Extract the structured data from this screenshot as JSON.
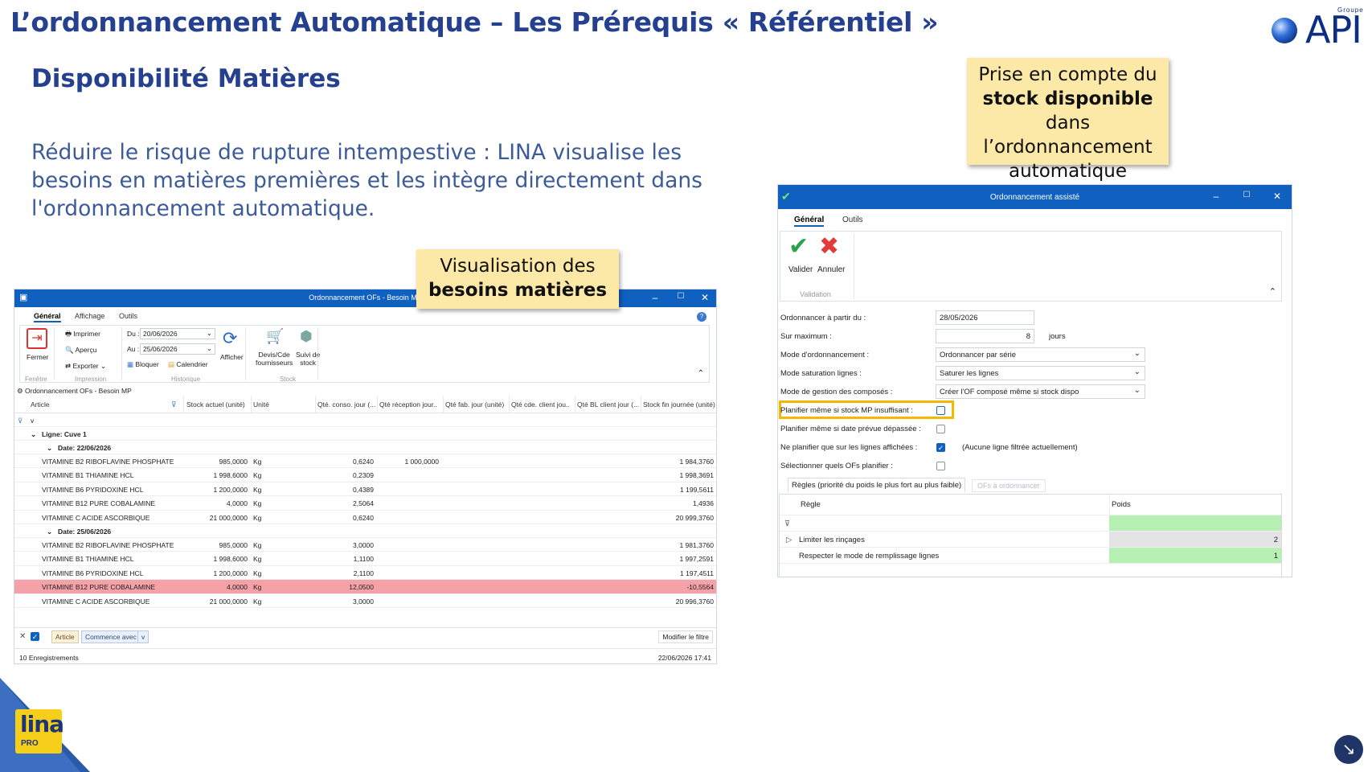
{
  "slide": {
    "title": "L’ordonnancement Automatique – Les Prérequis « Référentiel »",
    "subtitle": "Disponibilité Matières",
    "intro": "Réduire le risque de rupture intempestive : LINA visualise les besoins en matières premières et les intègre directement dans l'ordonnancement automatique.",
    "logo_text": "API",
    "logo_small": "Groupe"
  },
  "callouts": {
    "left_line1": "Visualisation des",
    "left_line2": "besoins matières",
    "right_line1": "Prise en compte du",
    "right_bold": "stock disponible",
    "right_rest": " dans l’ordonnancement automatique"
  },
  "left_window": {
    "title": "Ordonnancement OFs - Besoin MP",
    "tabs": [
      "Général",
      "Affichage",
      "Outils"
    ],
    "ribbon": {
      "fermer": "Fermer",
      "imprimer": "Imprimer",
      "apercu": "Aperçu",
      "exporter": "Exporter",
      "du_label": "Du :",
      "du_value": "20/06/2026",
      "au_label": "Au :",
      "au_value": "25/06/2026",
      "bloquer": "Bloquer",
      "calendrier": "Calendrier",
      "afficher": "Afficher",
      "devis": "Devis/Cde\nfournisseurs",
      "suivi": "Suivi de\nstock",
      "group_fenetre": "Fenêtre",
      "group_impression": "Impression",
      "group_historique": "Historique",
      "group_stock": "Stock"
    },
    "panel_title": "Ordonnancement OFs - Besoin MP",
    "columns": [
      "Article",
      "Stock actuel (unité)",
      "Unité",
      "Qté. conso. jour (...",
      "Qté réception jour...",
      "Qté fab. jour (unité)",
      "Qté cde. client jou...",
      "Qté BL client jour (...",
      "Stock fin journée (unité)"
    ],
    "filter_value": "v",
    "group_ligne": "Ligne: Cuve 1",
    "group_date1": "Date: 22/06/2026",
    "group_date2": "Date: 25/06/2026",
    "rows_date1": [
      {
        "article": "VITAMINE B2 RIBOFLAVINE PHOSPHATE",
        "stock": "985,0000",
        "unite": "Kg",
        "conso": "0,6240",
        "recep": "1 000,0000",
        "fin": "1 984,3760"
      },
      {
        "article": "VITAMINE B1 THIAMINE HCL",
        "stock": "1 998,6000",
        "unite": "Kg",
        "conso": "0,2309",
        "recep": "",
        "fin": "1 998,3691"
      },
      {
        "article": "VITAMINE B6 PYRIDOXINE HCL",
        "stock": "1 200,0000",
        "unite": "Kg",
        "conso": "0,4389",
        "recep": "",
        "fin": "1 199,5611"
      },
      {
        "article": "VITAMINE B12 PURE COBALAMINE",
        "stock": "4,0000",
        "unite": "Kg",
        "conso": "2,5064",
        "recep": "",
        "fin": "1,4936"
      },
      {
        "article": "VITAMINE C ACIDE ASCORBIQUE",
        "stock": "21 000,0000",
        "unite": "Kg",
        "conso": "0,6240",
        "recep": "",
        "fin": "20 999,3760"
      }
    ],
    "rows_date2": [
      {
        "article": "VITAMINE B2 RIBOFLAVINE PHOSPHATE",
        "stock": "985,0000",
        "unite": "Kg",
        "conso": "3,0000",
        "recep": "",
        "fin": "1 981,3760"
      },
      {
        "article": "VITAMINE B1 THIAMINE HCL",
        "stock": "1 998,6000",
        "unite": "Kg",
        "conso": "1,1100",
        "recep": "",
        "fin": "1 997,2591"
      },
      {
        "article": "VITAMINE B6 PYRIDOXINE HCL",
        "stock": "1 200,0000",
        "unite": "Kg",
        "conso": "2,1100",
        "recep": "",
        "fin": "1 197,4511"
      },
      {
        "article": "VITAMINE B12 PURE COBALAMINE",
        "stock": "4,0000",
        "unite": "Kg",
        "conso": "12,0500",
        "recep": "",
        "fin": "-10,5564"
      },
      {
        "article": "VITAMINE C ACIDE ASCORBIQUE",
        "stock": "21 000,0000",
        "unite": "Kg",
        "conso": "3,0000",
        "recep": "",
        "fin": "20 996,3760"
      }
    ],
    "filter_chip_article": "Article",
    "filter_chip_op": "Commence avec",
    "filter_chip_val": "v",
    "modify_filter": "Modifier le filtre",
    "records": "10 Enregistrements",
    "datetime": "22/06/2026 17:41"
  },
  "right_window": {
    "title": "Ordonnancement assisté",
    "tabs": [
      "Général",
      "Outils"
    ],
    "valider": "Valider",
    "annuler": "Annuler",
    "group_validation": "Validation",
    "fields": {
      "ordonnancer_label": "Ordonnancer à partir du :",
      "ordonnancer_value": "28/05/2026",
      "sur_max_label": "Sur maximum :",
      "sur_max_value": "8",
      "sur_max_unit": "jours",
      "mode_ord_label": "Mode d'ordonnancement :",
      "mode_ord_value": "Ordonnancer par série",
      "mode_sat_label": "Mode saturation lignes :",
      "mode_sat_value": "Saturer les lignes",
      "mode_comp_label": "Mode de gestion des composés :",
      "mode_comp_value": "Créer l'OF composé même si stock dispo",
      "planifier_mp_label": "Planifier même si stock MP insuffisant :",
      "planifier_date_label": "Planifier même si date prévue dépassée :",
      "ne_planifier_label": "Ne planifier que sur les lignes affichées :",
      "ne_planifier_note": "(Aucune ligne filtrée actuellement)",
      "selectionner_label": "Sélectionner quels OFs planifier :"
    },
    "subtabs": [
      "Règles (priorité du poids le plus fort au plus faible)",
      "OFs à ordonnancer"
    ],
    "grid_headers": [
      "Règle",
      "Poids"
    ],
    "rules": [
      {
        "regle": "Limiter les rinçages",
        "poids": "2"
      },
      {
        "regle": "Respecter le mode de remplissage lignes",
        "poids": "1"
      }
    ]
  },
  "brand": {
    "lina": "lina",
    "pro": "PRO"
  },
  "colors": {
    "title_blue": "#24408e",
    "window_blue": "#1060c0",
    "callout_yellow": "#fde9a7",
    "highlight_red": "#f4a1a8",
    "green_cell": "#b6f0b2",
    "highlight_border": "#f5b800"
  }
}
